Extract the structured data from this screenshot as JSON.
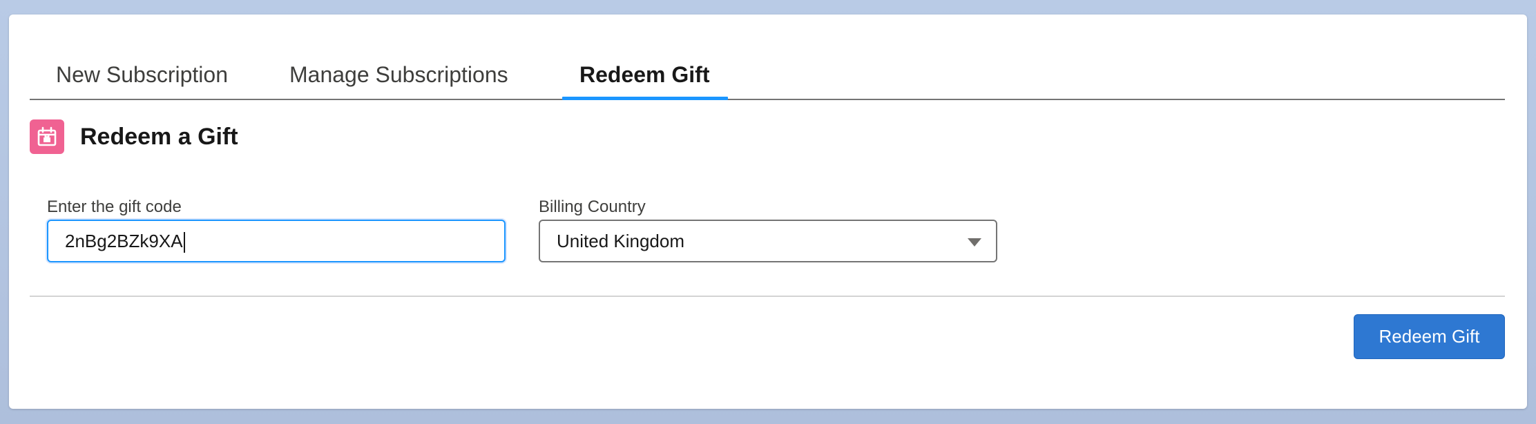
{
  "tabs": [
    {
      "label": "New Subscription",
      "active": false
    },
    {
      "label": "Manage Subscriptions",
      "active": false
    },
    {
      "label": "Redeem Gift",
      "active": true
    }
  ],
  "section": {
    "title": "Redeem a Gift",
    "icon": "gift-icon",
    "icon_color": "#f06292"
  },
  "form": {
    "gift_code_label": "Enter the gift code",
    "gift_code_value": "2nBg2BZk9XA",
    "country_label": "Billing Country",
    "country_value": "United Kingdom"
  },
  "actions": {
    "redeem_label": "Redeem Gift",
    "accent_color": "#2e78d2"
  },
  "colors": {
    "tab_active_underline": "#1b96ff",
    "focus_border": "#1b96ff"
  }
}
